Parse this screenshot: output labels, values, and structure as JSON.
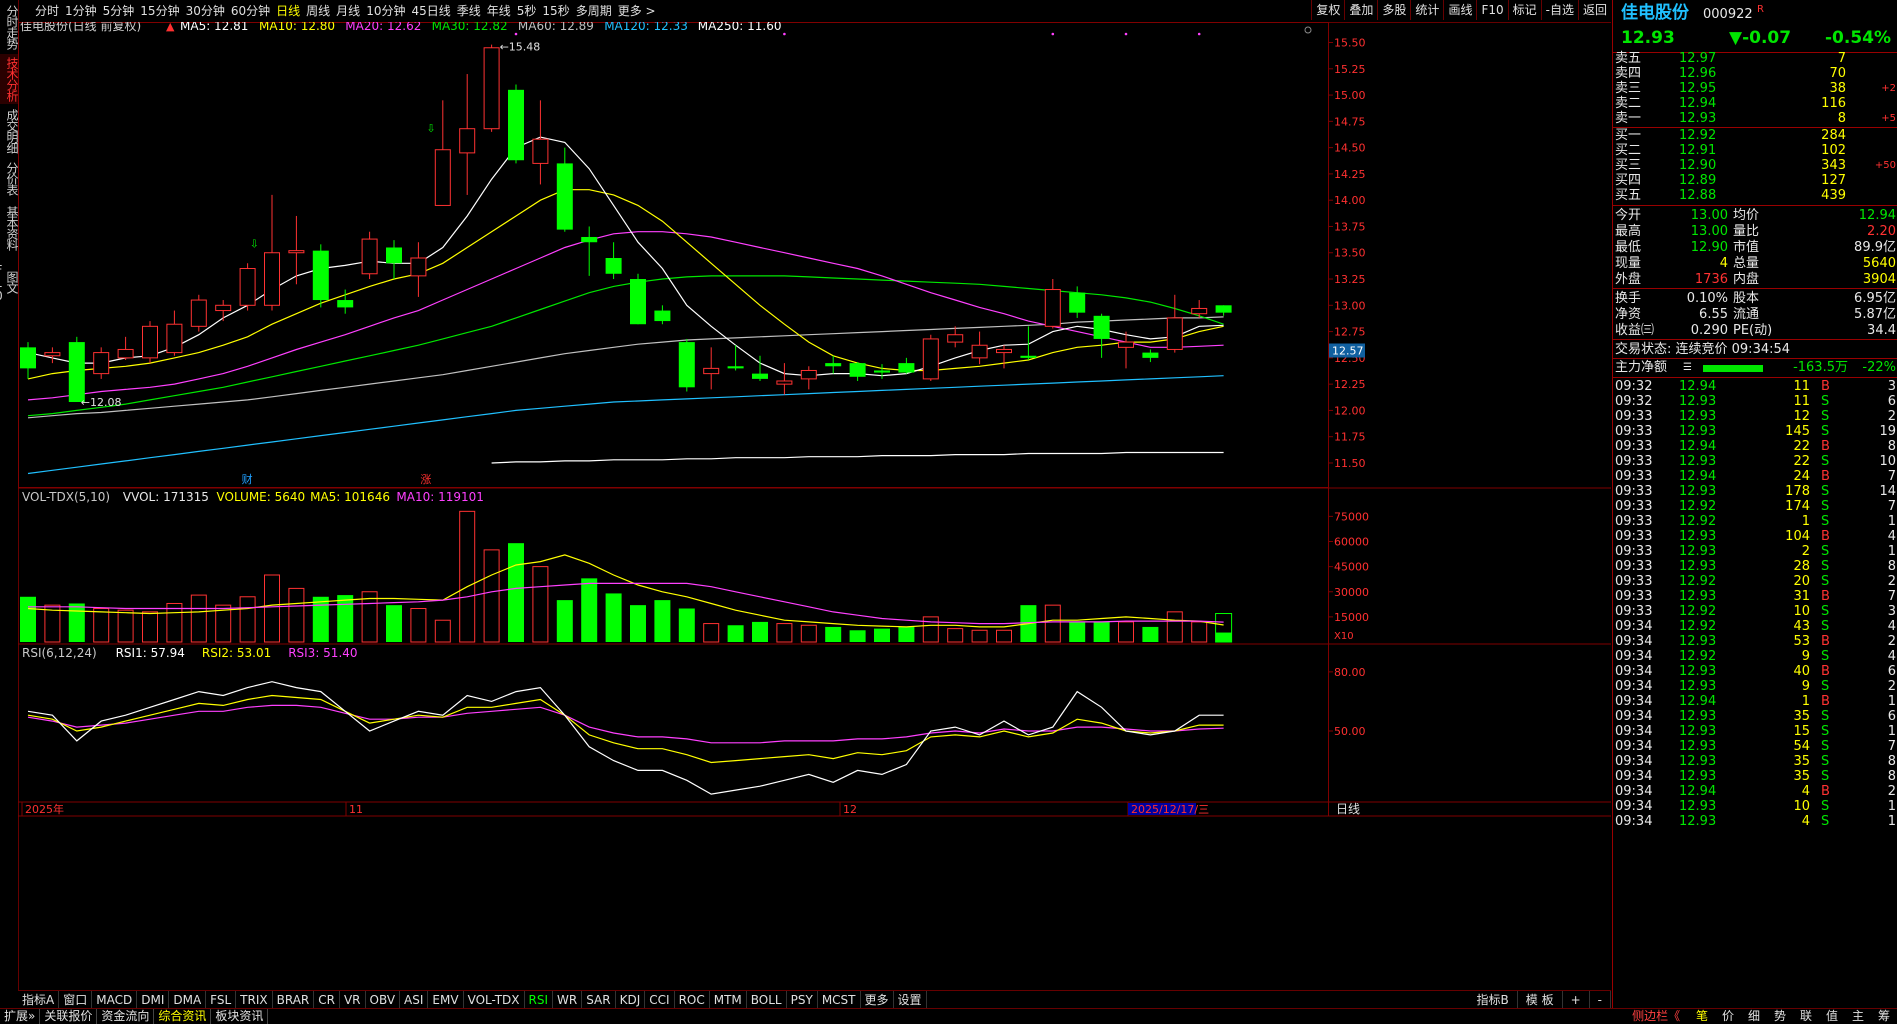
{
  "left_tabs": [
    "分时走势",
    "技术分析",
    "成交明细",
    "分价表",
    "基本资料",
    "图文F10"
  ],
  "active_left_tab": 1,
  "period_tabs": [
    "分时",
    "1分钟",
    "5分钟",
    "15分钟",
    "30分钟",
    "60分钟",
    "日线",
    "周线",
    "月线",
    "10分钟",
    "45日线",
    "季线",
    "年线",
    "5秒",
    "15秒",
    "多周期",
    "更多 >"
  ],
  "active_period": 6,
  "toolbar": [
    "复权",
    "叠加",
    "多股",
    "统计",
    "画线",
    "F10",
    "标记",
    "-自选",
    "返回"
  ],
  "main_legend": {
    "title": "佳电股份(日线 前复权)",
    "items": [
      {
        "label": "MA5: 12.81",
        "color": "#ffffff"
      },
      {
        "label": "MA10: 12.80",
        "color": "#ffff00"
      },
      {
        "label": "MA20: 12.62",
        "color": "#ff40ff"
      },
      {
        "label": "MA30: 12.82",
        "color": "#00e600"
      },
      {
        "label": "MA60: 12.89",
        "color": "#c0c0c0"
      },
      {
        "label": "MA120: 12.33",
        "color": "#20c0ff"
      },
      {
        "label": "MA250: 11.60",
        "color": "#ffffff"
      }
    ]
  },
  "vol_legend": {
    "items": [
      {
        "label": "VOL-TDX(5,10)",
        "color": "#c8c8c8"
      },
      {
        "label": "VVOL: 171315",
        "color": "#e8e8e8"
      },
      {
        "label": "VOLUME: 5640",
        "color": "#ffff00"
      },
      {
        "label": "MA5: 101646",
        "color": "#ffff00"
      },
      {
        "label": "MA10: 119101",
        "color": "#ff40ff"
      }
    ]
  },
  "rsi_legend": {
    "items": [
      {
        "label": "RSI(6,12,24)",
        "color": "#c8c8c8"
      },
      {
        "label": "RSI1: 57.94",
        "color": "#ffffff"
      },
      {
        "label": "RSI2: 53.01",
        "color": "#ffff00"
      },
      {
        "label": "RSI3: 51.40",
        "color": "#ff40ff"
      }
    ]
  },
  "price_axis": [
    "15.50",
    "15.25",
    "15.00",
    "14.75",
    "14.50",
    "14.25",
    "14.00",
    "13.75",
    "13.50",
    "13.25",
    "13.00",
    "12.75",
    "12.50",
    "12.25",
    "12.00",
    "11.75",
    "11.50"
  ],
  "current_price_tag": "12.57",
  "vol_axis": [
    "75000",
    "60000",
    "45000",
    "30000",
    "15000"
  ],
  "vol_unit": "X10",
  "rsi_axis": [
    "80.00",
    "50.00"
  ],
  "time_axis": [
    {
      "label": "2025年",
      "x": 0
    },
    {
      "label": "11",
      "x": 0
    },
    {
      "label": "12",
      "x": 0
    },
    {
      "label": "2025/12/17/三",
      "x": 0
    }
  ],
  "time_axis_right": "日线",
  "annotations": {
    "high": "15.48",
    "low": "12.08",
    "cai": "财",
    "zhang": "涨"
  },
  "chart_data": {
    "type": "candlestick",
    "ylim": [
      11.3,
      15.6
    ],
    "candles": [
      [
        12.6,
        12.4,
        12.65,
        12.3
      ],
      [
        12.52,
        12.55,
        12.6,
        12.45
      ],
      [
        12.65,
        12.08,
        12.7,
        12.08
      ],
      [
        12.35,
        12.55,
        12.6,
        12.3
      ],
      [
        12.5,
        12.58,
        12.7,
        12.48
      ],
      [
        12.5,
        12.8,
        12.85,
        12.45
      ],
      [
        12.55,
        12.82,
        12.95,
        12.52
      ],
      [
        12.8,
        13.05,
        13.1,
        12.75
      ],
      [
        12.95,
        13.0,
        13.05,
        12.85
      ],
      [
        13.0,
        13.35,
        13.4,
        12.95
      ],
      [
        13.0,
        13.5,
        14.05,
        12.95
      ],
      [
        13.5,
        13.52,
        13.85,
        13.2
      ],
      [
        13.52,
        13.05,
        13.58,
        12.98
      ],
      [
        13.05,
        12.98,
        13.15,
        12.92
      ],
      [
        13.3,
        13.63,
        13.7,
        13.25
      ],
      [
        13.55,
        13.4,
        13.62,
        13.25
      ],
      [
        13.28,
        13.45,
        13.6,
        13.08
      ],
      [
        13.95,
        14.48,
        14.95,
        14.25
      ],
      [
        14.45,
        14.68,
        15.2,
        14.05
      ],
      [
        14.68,
        15.45,
        15.48,
        14.65
      ],
      [
        15.05,
        14.38,
        15.1,
        14.35
      ],
      [
        14.35,
        14.58,
        14.95,
        14.15
      ],
      [
        14.35,
        13.72,
        14.5,
        13.7
      ],
      [
        13.65,
        13.6,
        13.75,
        13.28
      ],
      [
        13.45,
        13.3,
        13.6,
        13.25
      ],
      [
        13.25,
        12.82,
        13.3,
        12.82
      ],
      [
        12.95,
        12.85,
        13.0,
        12.82
      ],
      [
        12.65,
        12.22,
        12.68,
        12.18
      ],
      [
        12.35,
        12.4,
        12.6,
        12.2
      ],
      [
        12.42,
        12.4,
        12.62,
        12.38
      ],
      [
        12.35,
        12.3,
        12.52,
        12.28
      ],
      [
        12.25,
        12.28,
        12.45,
        12.15
      ],
      [
        12.3,
        12.38,
        12.42,
        12.2
      ],
      [
        12.45,
        12.42,
        12.52,
        12.35
      ],
      [
        12.45,
        12.32,
        12.46,
        12.28
      ],
      [
        12.38,
        12.36,
        12.44,
        12.3
      ],
      [
        12.45,
        12.36,
        12.5,
        12.35
      ],
      [
        12.3,
        12.68,
        12.72,
        12.28
      ],
      [
        12.65,
        12.72,
        12.8,
        12.6
      ],
      [
        12.5,
        12.62,
        12.75,
        12.44
      ],
      [
        12.55,
        12.58,
        12.62,
        12.4
      ],
      [
        12.52,
        12.5,
        12.8,
        12.48
      ],
      [
        12.8,
        13.15,
        13.25,
        12.78
      ],
      [
        13.12,
        12.93,
        13.18,
        12.88
      ],
      [
        12.9,
        12.68,
        12.92,
        12.5
      ],
      [
        12.6,
        12.65,
        12.75,
        12.4
      ],
      [
        12.55,
        12.5,
        12.58,
        12.46
      ],
      [
        12.58,
        12.88,
        13.1,
        12.55
      ],
      [
        12.92,
        12.97,
        13.05,
        12.88
      ],
      [
        13.0,
        12.93,
        13.0,
        12.9
      ]
    ],
    "ma5": [
      12.55,
      12.5,
      12.45,
      12.45,
      12.5,
      12.52,
      12.6,
      12.72,
      12.88,
      13.0,
      13.15,
      13.28,
      13.35,
      13.38,
      13.42,
      13.4,
      13.4,
      13.55,
      13.85,
      14.2,
      14.5,
      14.6,
      14.55,
      14.3,
      13.95,
      13.6,
      13.35,
      13.0,
      12.8,
      12.62,
      12.45,
      12.35,
      12.33,
      12.35,
      12.35,
      12.33,
      12.35,
      12.42,
      12.5,
      12.57,
      12.62,
      12.63,
      12.75,
      12.8,
      12.77,
      12.72,
      12.68,
      12.7,
      12.8,
      12.81
    ],
    "ma10": [
      12.3,
      12.35,
      12.38,
      12.4,
      12.42,
      12.45,
      12.5,
      12.55,
      12.62,
      12.7,
      12.82,
      12.92,
      13.02,
      13.1,
      13.18,
      13.25,
      13.3,
      13.4,
      13.55,
      13.7,
      13.85,
      14.0,
      14.1,
      14.1,
      14.05,
      13.95,
      13.8,
      13.6,
      13.4,
      13.2,
      13.0,
      12.82,
      12.65,
      12.52,
      12.45,
      12.4,
      12.38,
      12.38,
      12.4,
      12.42,
      12.45,
      12.48,
      12.55,
      12.6,
      12.62,
      12.65,
      12.65,
      12.68,
      12.75,
      12.8
    ],
    "ma20": [
      12.1,
      12.12,
      12.15,
      12.18,
      12.2,
      12.22,
      12.25,
      12.3,
      12.35,
      12.42,
      12.5,
      12.58,
      12.65,
      12.72,
      12.8,
      12.88,
      12.95,
      13.05,
      13.15,
      13.25,
      13.35,
      13.45,
      13.55,
      13.62,
      13.68,
      13.7,
      13.7,
      13.68,
      13.65,
      13.6,
      13.55,
      13.5,
      13.45,
      13.4,
      13.35,
      13.28,
      13.2,
      13.12,
      13.05,
      12.98,
      12.92,
      12.85,
      12.8,
      12.75,
      12.7,
      12.65,
      12.6,
      12.6,
      12.61,
      12.62
    ],
    "ma30": [
      11.95,
      11.97,
      12.0,
      12.03,
      12.06,
      12.1,
      12.14,
      12.18,
      12.22,
      12.27,
      12.32,
      12.37,
      12.42,
      12.47,
      12.52,
      12.57,
      12.62,
      12.68,
      12.74,
      12.8,
      12.88,
      12.96,
      13.04,
      13.12,
      13.18,
      13.22,
      13.25,
      13.27,
      13.28,
      13.28,
      13.28,
      13.28,
      13.27,
      13.26,
      13.25,
      13.24,
      13.23,
      13.22,
      13.21,
      13.2,
      13.18,
      13.16,
      13.14,
      13.12,
      13.1,
      13.07,
      13.03,
      12.97,
      12.9,
      12.82
    ],
    "ma60": [
      11.93,
      11.95,
      11.97,
      11.98,
      12.0,
      12.02,
      12.04,
      12.06,
      12.08,
      12.1,
      12.13,
      12.16,
      12.19,
      12.22,
      12.25,
      12.28,
      12.31,
      12.34,
      12.38,
      12.42,
      12.46,
      12.5,
      12.54,
      12.57,
      12.6,
      12.63,
      12.65,
      12.67,
      12.68,
      12.69,
      12.7,
      12.71,
      12.72,
      12.73,
      12.74,
      12.75,
      12.76,
      12.77,
      12.78,
      12.79,
      12.8,
      12.81,
      12.82,
      12.84,
      12.85,
      12.86,
      12.87,
      12.88,
      12.88,
      12.89
    ],
    "ma120": [
      11.4,
      11.43,
      11.46,
      11.49,
      11.52,
      11.55,
      11.58,
      11.61,
      11.64,
      11.67,
      11.7,
      11.73,
      11.76,
      11.79,
      11.82,
      11.85,
      11.88,
      11.91,
      11.94,
      11.97,
      12.0,
      12.02,
      12.04,
      12.06,
      12.08,
      12.09,
      12.1,
      12.11,
      12.12,
      12.13,
      12.14,
      12.15,
      12.16,
      12.17,
      12.18,
      12.19,
      12.2,
      12.21,
      12.22,
      12.23,
      12.24,
      12.25,
      12.26,
      12.27,
      12.28,
      12.29,
      12.3,
      12.31,
      12.32,
      12.33
    ],
    "ma250_start": 19,
    "ma250": [
      11.5,
      11.51,
      11.51,
      11.52,
      11.52,
      11.53,
      11.53,
      11.53,
      11.54,
      11.54,
      11.55,
      11.55,
      11.55,
      11.56,
      11.56,
      11.56,
      11.57,
      11.57,
      11.57,
      11.58,
      11.58,
      11.58,
      11.59,
      11.59,
      11.59,
      11.59,
      11.6,
      11.6,
      11.6,
      11.6,
      11.6
    ],
    "volume": [
      27000,
      22000,
      23000,
      20000,
      19000,
      18000,
      23000,
      28000,
      22000,
      27000,
      40000,
      32000,
      27000,
      28000,
      30000,
      22000,
      20000,
      13000,
      78000,
      55000,
      59000,
      45000,
      25000,
      38000,
      29000,
      22000,
      25000,
      20000,
      11000,
      10000,
      12000,
      11000,
      10000,
      9000,
      7000,
      8000,
      9000,
      15000,
      8000,
      7000,
      7000,
      22000,
      22000,
      12000,
      12000,
      12000,
      9000,
      18000,
      12000,
      5640
    ],
    "vol_ma5": [
      20000,
      19000,
      18500,
      18000,
      17500,
      17000,
      17500,
      18000,
      19000,
      20000,
      22000,
      23000,
      24000,
      25000,
      26000,
      26000,
      25500,
      25000,
      33000,
      40000,
      46000,
      48000,
      52000,
      47000,
      40000,
      34000,
      30000,
      27000,
      23000,
      19000,
      16000,
      13000,
      12000,
      11000,
      10000,
      9500,
      9000,
      10000,
      10000,
      9000,
      9000,
      11000,
      13000,
      13000,
      14000,
      15000,
      14000,
      13000,
      12500,
      10164
    ],
    "vol_ma10": [
      21000,
      21000,
      21000,
      20500,
      20000,
      20000,
      20000,
      20000,
      20000,
      20500,
      21000,
      21500,
      22000,
      22500,
      23000,
      23500,
      24000,
      25000,
      27000,
      30000,
      32000,
      33000,
      34000,
      35000,
      35000,
      35000,
      35000,
      35000,
      33000,
      30000,
      27000,
      24000,
      21000,
      18000,
      16000,
      14000,
      13000,
      12000,
      11500,
      11000,
      11000,
      11500,
      12000,
      12000,
      12000,
      12500,
      12500,
      12500,
      12500,
      11910
    ],
    "vol_ylim": [
      0,
      80000
    ],
    "rsi1": [
      60,
      58,
      45,
      55,
      58,
      62,
      66,
      70,
      68,
      72,
      75,
      72,
      70,
      60,
      50,
      55,
      60,
      58,
      68,
      65,
      70,
      72,
      58,
      42,
      35,
      30,
      30,
      25,
      18,
      20,
      22,
      25,
      28,
      24,
      30,
      28,
      33,
      50,
      52,
      48,
      55,
      48,
      52,
      70,
      62,
      50,
      48,
      50,
      58,
      58
    ],
    "rsi2": [
      58,
      56,
      50,
      52,
      55,
      58,
      61,
      64,
      63,
      66,
      68,
      67,
      66,
      60,
      54,
      56,
      58,
      57,
      62,
      62,
      64,
      66,
      58,
      48,
      44,
      41,
      41,
      38,
      34,
      35,
      36,
      37,
      38,
      36,
      39,
      38,
      40,
      47,
      48,
      47,
      50,
      47,
      49,
      56,
      54,
      50,
      49,
      50,
      53,
      53
    ],
    "rsi3": [
      57,
      55,
      52,
      53,
      54,
      56,
      58,
      60,
      60,
      62,
      63,
      63,
      62,
      59,
      56,
      56,
      57,
      57,
      59,
      60,
      61,
      62,
      58,
      52,
      49,
      47,
      47,
      46,
      44,
      44,
      44,
      45,
      45,
      45,
      46,
      46,
      47,
      49,
      50,
      49,
      51,
      50,
      50,
      52,
      52,
      51,
      50,
      50,
      51,
      51.4
    ],
    "rsi_ylim": [
      15,
      85
    ]
  },
  "quote": {
    "name": "佳电股份",
    "code": "000922",
    "flag": "R",
    "price": "12.93",
    "change": "▼-0.07",
    "pct": "-0.54%"
  },
  "asks": [
    {
      "label": "卖五",
      "price": "12.97",
      "vol": "7",
      "chg": ""
    },
    {
      "label": "卖四",
      "price": "12.96",
      "vol": "70",
      "chg": ""
    },
    {
      "label": "卖三",
      "price": "12.95",
      "vol": "38",
      "chg": "+2"
    },
    {
      "label": "卖二",
      "price": "12.94",
      "vol": "116",
      "chg": ""
    },
    {
      "label": "卖一",
      "price": "12.93",
      "vol": "8",
      "chg": "+5"
    }
  ],
  "bids": [
    {
      "label": "买一",
      "price": "12.92",
      "vol": "284",
      "chg": ""
    },
    {
      "label": "买二",
      "price": "12.91",
      "vol": "102",
      "chg": ""
    },
    {
      "label": "买三",
      "price": "12.90",
      "vol": "343",
      "chg": "+50"
    },
    {
      "label": "买四",
      "price": "12.89",
      "vol": "127",
      "chg": ""
    },
    {
      "label": "买五",
      "price": "12.88",
      "vol": "439",
      "chg": ""
    }
  ],
  "stats": [
    {
      "l1": "今开",
      "v1": "13.00",
      "l2": "均价",
      "v2": "12.94"
    },
    {
      "l1": "最高",
      "v1": "13.00",
      "l2": "量比",
      "v2": "2.20"
    },
    {
      "l1": "最低",
      "v1": "12.90",
      "l2": "市值",
      "v2": "89.9亿"
    },
    {
      "l1": "现量",
      "v1": "4",
      "l2": "总量",
      "v2": "5640"
    },
    {
      "l1": "外盘",
      "v1": "1736",
      "l2": "内盘",
      "v2": "3904"
    }
  ],
  "stats2": [
    {
      "l1": "换手",
      "v1": "0.10%",
      "l2": "股本",
      "v2": "6.95亿"
    },
    {
      "l1": "净资",
      "v1": "6.55",
      "l2": "流通",
      "v2": "5.87亿"
    },
    {
      "l1": "收益㈢",
      "v1": "0.290",
      "l2": "PE(动)",
      "v2": "34.4"
    }
  ],
  "trade_status": "交易状态: 连续竞价 09:34:54",
  "main_flow": {
    "label": "主力净额",
    "value": "-163.5万",
    "pct": "-22%"
  },
  "ticks": [
    [
      "09:32",
      "12.94",
      "11",
      "B",
      "3"
    ],
    [
      "09:32",
      "12.93",
      "11",
      "S",
      "6"
    ],
    [
      "09:33",
      "12.93",
      "12",
      "S",
      "2"
    ],
    [
      "09:33",
      "12.93",
      "145",
      "S",
      "19"
    ],
    [
      "09:33",
      "12.94",
      "22",
      "B",
      "8"
    ],
    [
      "09:33",
      "12.93",
      "22",
      "S",
      "10"
    ],
    [
      "09:33",
      "12.94",
      "24",
      "B",
      "7"
    ],
    [
      "09:33",
      "12.93",
      "178",
      "S",
      "14"
    ],
    [
      "09:33",
      "12.92",
      "174",
      "S",
      "7"
    ],
    [
      "09:33",
      "12.92",
      "1",
      "S",
      "1"
    ],
    [
      "09:33",
      "12.93",
      "104",
      "B",
      "4"
    ],
    [
      "09:33",
      "12.93",
      "2",
      "S",
      "1"
    ],
    [
      "09:33",
      "12.93",
      "28",
      "S",
      "8"
    ],
    [
      "09:33",
      "12.92",
      "20",
      "S",
      "2"
    ],
    [
      "09:33",
      "12.93",
      "31",
      "B",
      "7"
    ],
    [
      "09:33",
      "12.92",
      "10",
      "S",
      "3"
    ],
    [
      "09:34",
      "12.92",
      "43",
      "S",
      "4"
    ],
    [
      "09:34",
      "12.93",
      "53",
      "B",
      "2"
    ],
    [
      "09:34",
      "12.92",
      "9",
      "S",
      "4"
    ],
    [
      "09:34",
      "12.93",
      "40",
      "B",
      "6"
    ],
    [
      "09:34",
      "12.93",
      "9",
      "S",
      "2"
    ],
    [
      "09:34",
      "12.94",
      "1",
      "B",
      "1"
    ],
    [
      "09:34",
      "12.93",
      "35",
      "S",
      "6"
    ],
    [
      "09:34",
      "12.93",
      "15",
      "S",
      "1"
    ],
    [
      "09:34",
      "12.93",
      "54",
      "S",
      "7"
    ],
    [
      "09:34",
      "12.93",
      "35",
      "S",
      "8"
    ],
    [
      "09:34",
      "12.93",
      "35",
      "S",
      "8"
    ],
    [
      "09:34",
      "12.94",
      "4",
      "B",
      "2"
    ],
    [
      "09:34",
      "12.93",
      "10",
      "S",
      "1"
    ],
    [
      "09:34",
      "12.93",
      "4",
      "S",
      "1"
    ]
  ],
  "indicator_tabs": [
    "指标A",
    "窗口",
    "MACD",
    "DMI",
    "DMA",
    "FSL",
    "TRIX",
    "BRAR",
    "CR",
    "VR",
    "OBV",
    "ASI",
    "EMV",
    "VOL-TDX",
    "RSI",
    "WR",
    "SAR",
    "KDJ",
    "CCI",
    "ROC",
    "MTM",
    "BOLL",
    "PSY",
    "MCST",
    "更多",
    "设置"
  ],
  "active_indicator": 14,
  "indicator_right": [
    "指标B",
    "模 板",
    "+",
    "-"
  ],
  "status_tabs": [
    "扩展»",
    "关联报价",
    "资金流向",
    "综合资讯",
    "板块资讯"
  ],
  "active_status": 3,
  "sidebar_label": "侧边栏《",
  "right_tabs": [
    "笔",
    "价",
    "细",
    "势",
    "联",
    "值",
    "主",
    "筹"
  ],
  "active_right_tab": 0
}
